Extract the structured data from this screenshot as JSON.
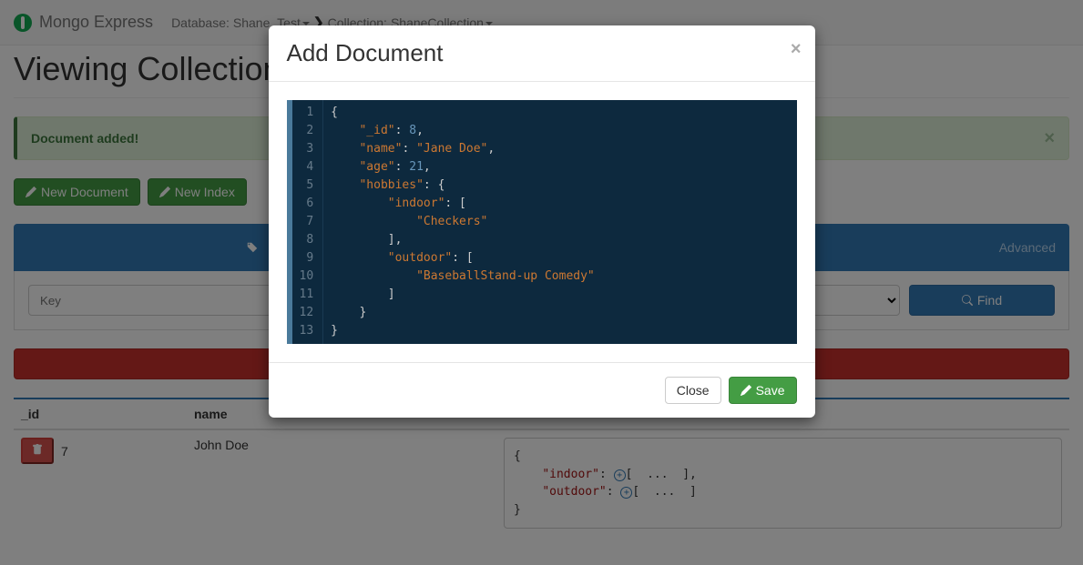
{
  "navbar": {
    "brand": "Mongo Express",
    "db_label": "Database:",
    "db_name": "Shane_Test",
    "coll_label": "Collection:",
    "coll_name": "ShaneCollection"
  },
  "page": {
    "title": "Viewing Collection: ShaneCollection"
  },
  "alert": {
    "text": "Document added!"
  },
  "buttons": {
    "new_document": "New Document",
    "new_index": "New Index",
    "find": "Find",
    "close": "Close",
    "save": "Save"
  },
  "search": {
    "advanced_label": "Advanced",
    "key_placeholder": "Key"
  },
  "table": {
    "headers": {
      "id": "_id",
      "name": "name"
    },
    "rows": [
      {
        "id": "7",
        "name": "John Doe"
      }
    ]
  },
  "hobbies_preview": {
    "indoor_key": "\"indoor\"",
    "outdoor_key": "\"outdoor\"",
    "placeholder": "..."
  },
  "modal": {
    "title": "Add Document",
    "code_lines": [
      "{",
      "    \"_id\": 8,",
      "    \"name\": \"Jane Doe\",",
      "    \"age\": 21,",
      "    \"hobbies\": {",
      "        \"indoor\": [",
      "            \"Checkers\"",
      "        ],",
      "        \"outdoor\": [",
      "            \"BaseballStand-up Comedy\"",
      "        ]",
      "    }",
      "}"
    ]
  },
  "chart_data": {
    "type": "table",
    "document": {
      "_id": 8,
      "name": "Jane Doe",
      "age": 21,
      "hobbies": {
        "indoor": [
          "Checkers"
        ],
        "outdoor": [
          "BaseballStand-up Comedy"
        ]
      }
    }
  }
}
